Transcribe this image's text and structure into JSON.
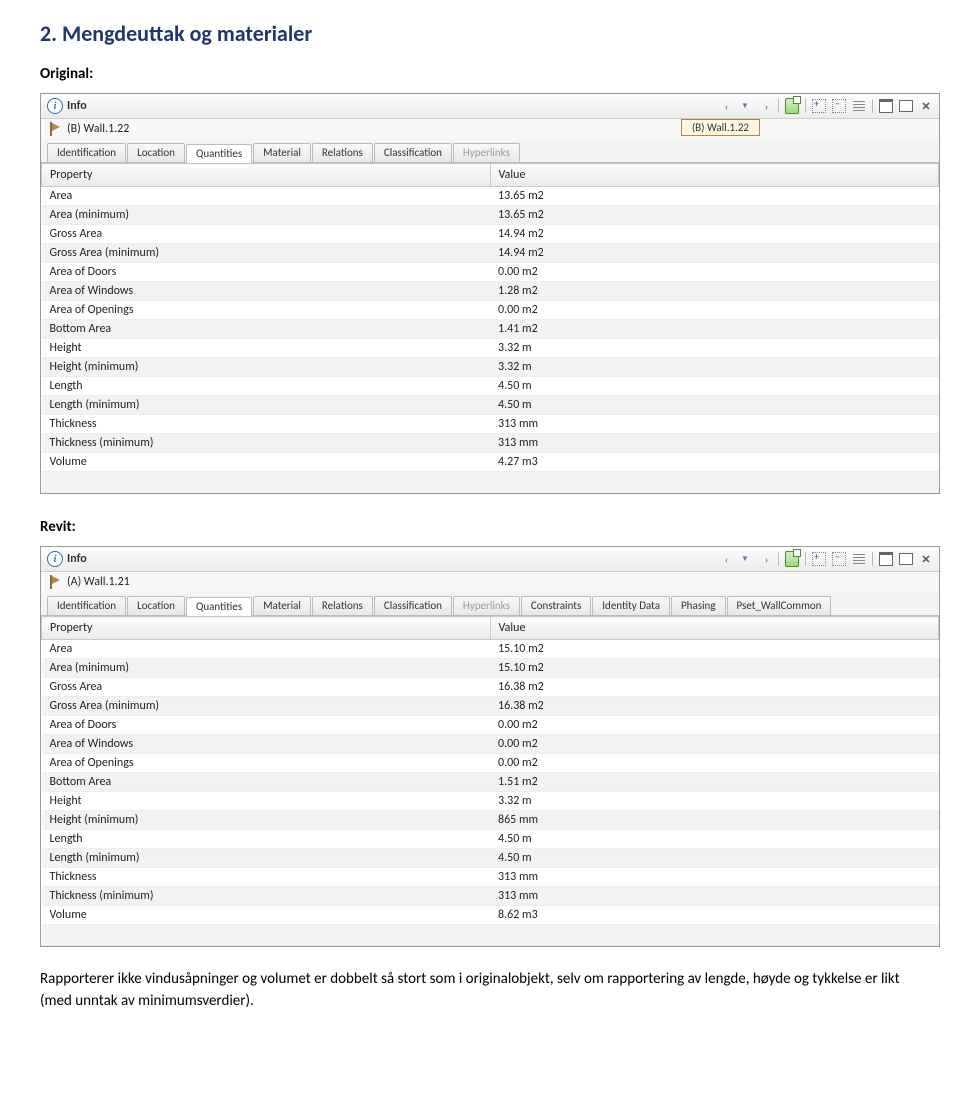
{
  "doc": {
    "heading": "2.  Mengdeuttak og materialer",
    "label_original": "Original:",
    "label_revit": "Revit:",
    "body_text": "Rapporterer ikke vindusåpninger og volumet er dobbelt så stort som i originalobjekt, selv om rapportering av lengde, høyde og tykkelse er likt (med unntak av minimumsverdier)."
  },
  "panel1": {
    "title": "Info",
    "object_name": "(B) Wall.1.22",
    "selection_chip": "(B) Wall.1.22",
    "tabs": [
      "Identification",
      "Location",
      "Quantities",
      "Material",
      "Relations",
      "Classification",
      "Hyperlinks"
    ],
    "active_tab": 2,
    "disabled_tabs": [
      6
    ],
    "columns": {
      "prop": "Property",
      "val": "Value"
    },
    "rows": [
      {
        "p": "Area",
        "v": "13.65 m2"
      },
      {
        "p": "Area (minimum)",
        "v": "13.65 m2"
      },
      {
        "p": "Gross Area",
        "v": "14.94 m2"
      },
      {
        "p": "Gross Area (minimum)",
        "v": "14.94 m2"
      },
      {
        "p": "Area of Doors",
        "v": "0.00 m2"
      },
      {
        "p": "Area of Windows",
        "v": "1.28 m2"
      },
      {
        "p": "Area of Openings",
        "v": "0.00 m2"
      },
      {
        "p": "Bottom Area",
        "v": "1.41 m2"
      },
      {
        "p": "Height",
        "v": "3.32 m"
      },
      {
        "p": "Height (minimum)",
        "v": "3.32 m"
      },
      {
        "p": "Length",
        "v": "4.50 m"
      },
      {
        "p": "Length (minimum)",
        "v": "4.50 m"
      },
      {
        "p": "Thickness",
        "v": "313 mm"
      },
      {
        "p": "Thickness (minimum)",
        "v": "313 mm"
      },
      {
        "p": "Volume",
        "v": "4.27 m3"
      }
    ]
  },
  "panel2": {
    "title": "Info",
    "object_name": "(A) Wall.1.21",
    "tabs": [
      "Identification",
      "Location",
      "Quantities",
      "Material",
      "Relations",
      "Classification",
      "Hyperlinks",
      "Constraints",
      "Identity Data",
      "Phasing",
      "Pset_WallCommon"
    ],
    "active_tab": 2,
    "disabled_tabs": [
      6
    ],
    "columns": {
      "prop": "Property",
      "val": "Value"
    },
    "rows": [
      {
        "p": "Area",
        "v": "15.10 m2"
      },
      {
        "p": "Area (minimum)",
        "v": "15.10 m2"
      },
      {
        "p": "Gross Area",
        "v": "16.38 m2"
      },
      {
        "p": "Gross Area (minimum)",
        "v": "16.38 m2"
      },
      {
        "p": "Area of Doors",
        "v": "0.00 m2"
      },
      {
        "p": "Area of Windows",
        "v": "0.00 m2"
      },
      {
        "p": "Area of Openings",
        "v": "0.00 m2"
      },
      {
        "p": "Bottom Area",
        "v": "1.51 m2"
      },
      {
        "p": "Height",
        "v": "3.32 m"
      },
      {
        "p": "Height (minimum)",
        "v": "865 mm"
      },
      {
        "p": "Length",
        "v": "4.50 m"
      },
      {
        "p": "Length (minimum)",
        "v": "4.50 m"
      },
      {
        "p": "Thickness",
        "v": "313 mm"
      },
      {
        "p": "Thickness (minimum)",
        "v": "313 mm"
      },
      {
        "p": "Volume",
        "v": "8.62 m3"
      }
    ]
  }
}
